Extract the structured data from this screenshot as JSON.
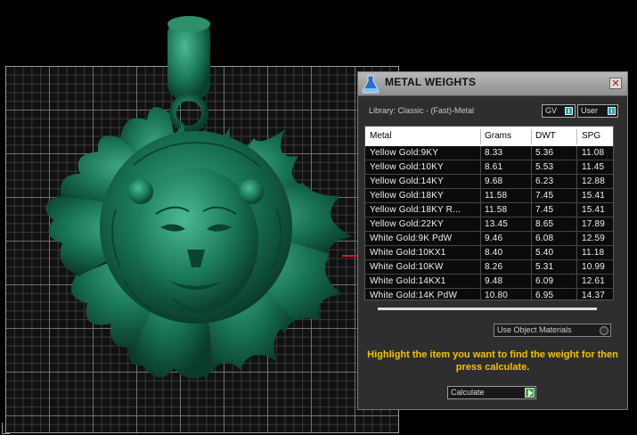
{
  "panel": {
    "title": "METAL WEIGHTS",
    "close_symbol": "✕",
    "library_label": "Library: Classic - (Fast)-Metal",
    "toggles": [
      {
        "label": "GV"
      },
      {
        "label": "User"
      }
    ],
    "table": {
      "columns": [
        "Metal",
        "Grams",
        "DWT",
        "SPG"
      ],
      "rows": [
        {
          "metal": "Yellow Gold:9KY",
          "grams": "8.33",
          "dwt": "5.36",
          "spg": "11.08"
        },
        {
          "metal": "Yellow Gold:10KY",
          "grams": "8.61",
          "dwt": "5.53",
          "spg": "11.45"
        },
        {
          "metal": "Yellow Gold:14KY",
          "grams": "9.68",
          "dwt": "6.23",
          "spg": "12.88"
        },
        {
          "metal": "Yellow Gold:18KY",
          "grams": "11.58",
          "dwt": "7.45",
          "spg": "15.41"
        },
        {
          "metal": "Yellow Gold:18KY R...",
          "grams": "11.58",
          "dwt": "7.45",
          "spg": "15.41"
        },
        {
          "metal": "Yellow Gold:22KY",
          "grams": "13.45",
          "dwt": "8.65",
          "spg": "17.89"
        },
        {
          "metal": "White Gold:9K PdW",
          "grams": "9.46",
          "dwt": "6.08",
          "spg": "12.59"
        },
        {
          "metal": "White Gold:10KX1",
          "grams": "8.40",
          "dwt": "5.40",
          "spg": "11.18"
        },
        {
          "metal": "White Gold:10KW",
          "grams": "8.26",
          "dwt": "5.31",
          "spg": "10.99"
        },
        {
          "metal": "White Gold:14KX1",
          "grams": "9.48",
          "dwt": "6.09",
          "spg": "12.61"
        },
        {
          "metal": "White Gold:14K PdW",
          "grams": "10.80",
          "dwt": "6.95",
          "spg": "14.37"
        }
      ]
    },
    "use_object_materials": "Use Object Materials",
    "instruction": "Highlight the item you want to find the weight for then press calculate.",
    "calculate_label": "Calculate"
  },
  "icons": {
    "app": "flask-icon",
    "close": "close-icon",
    "toggle": "toggle-switch-icon",
    "radio": "radio-icon",
    "go": "play-arrow-icon"
  },
  "colors": {
    "model_green": "#1a6e52",
    "instruction_yellow": "#f2c200",
    "panel_bg": "#2e2e2e"
  }
}
